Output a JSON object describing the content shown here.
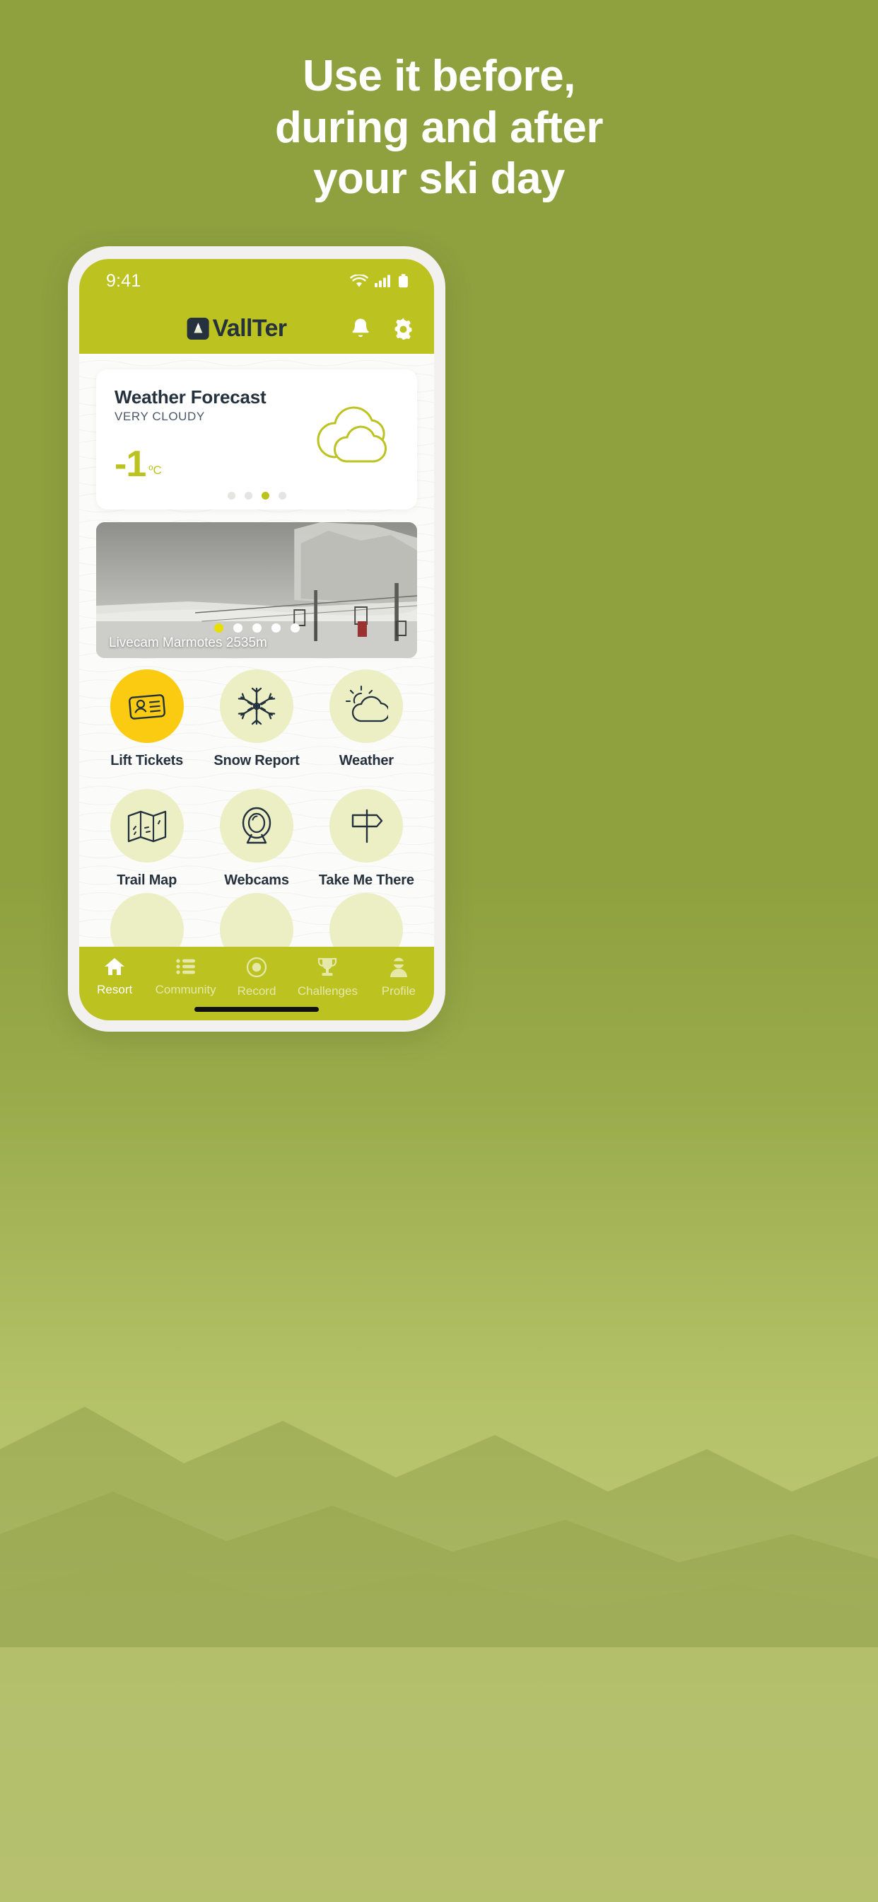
{
  "promo": {
    "headline_lines": [
      "Use it before,",
      "during and after",
      "your ski day"
    ],
    "background_color": "#8fa03f"
  },
  "phone": {
    "status_bar": {
      "time": "9:41",
      "icons": [
        "wifi-icon",
        "cellular-icon",
        "battery-icon"
      ]
    },
    "app_header": {
      "brand_name": "VallTer",
      "brand_mark": "mountain-peak-icon",
      "actions": [
        {
          "name": "notifications-button",
          "icon": "bell-icon"
        },
        {
          "name": "settings-button",
          "icon": "gear-icon"
        }
      ]
    },
    "weather_card": {
      "title": "Weather Forecast",
      "condition": "VERY CLOUDY",
      "temperature": "-1",
      "unit": "ºC",
      "icon": "very-cloudy-icon",
      "accent_color": "#bcc21f",
      "dots": {
        "count": 4,
        "active_index": 2
      }
    },
    "livecam": {
      "caption": "Livecam Marmotes 2535m",
      "dots": {
        "count": 5,
        "active_index": 0
      },
      "active_dot_color": "#e8df00"
    },
    "shortcuts": [
      {
        "label": "Lift Tickets",
        "icon": "id-card-icon",
        "bubble": "accent"
      },
      {
        "label": "Snow Report",
        "icon": "snowflake-icon",
        "bubble": "default"
      },
      {
        "label": "Weather",
        "icon": "sun-cloud-icon",
        "bubble": "default"
      },
      {
        "label": "Trail Map",
        "icon": "folded-map-icon",
        "bubble": "default"
      },
      {
        "label": "Webcams",
        "icon": "webcam-icon",
        "bubble": "default"
      },
      {
        "label": "Take Me There",
        "icon": "signpost-icon",
        "bubble": "default"
      }
    ],
    "tab_bar": {
      "active_index": 0,
      "items": [
        {
          "label": "Resort",
          "icon": "home-icon"
        },
        {
          "label": "Community",
          "icon": "list-icon"
        },
        {
          "label": "Record",
          "icon": "record-icon"
        },
        {
          "label": "Challenges",
          "icon": "trophy-icon"
        },
        {
          "label": "Profile",
          "icon": "person-goggles-icon"
        }
      ]
    }
  }
}
